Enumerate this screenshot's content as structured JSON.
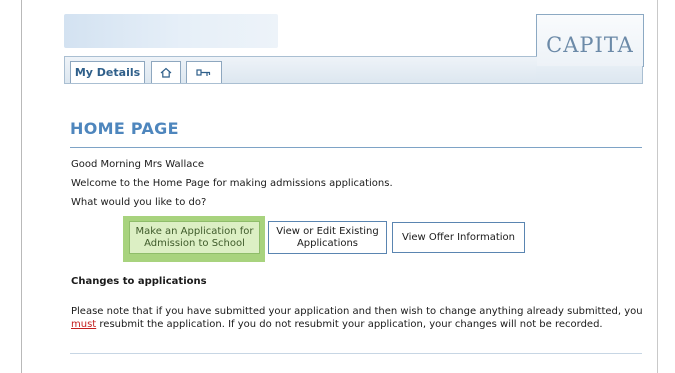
{
  "header": {
    "brand": "CAPITA",
    "tabs": [
      {
        "label": "My Details",
        "icon": "none"
      },
      {
        "label": "",
        "icon": "home-icon"
      },
      {
        "label": "",
        "icon": "key-icon"
      }
    ]
  },
  "main": {
    "title": "HOME PAGE",
    "greeting": "Good Morning Mrs Wallace",
    "welcome": "Welcome to the Home Page for making admissions applications.",
    "question": "What would you like to do?",
    "options": [
      {
        "label": "Make an Application for\nAdmission to School",
        "highlighted": true
      },
      {
        "label": "View or Edit Existing\nApplications",
        "highlighted": false
      },
      {
        "label": "View Offer Information",
        "highlighted": false
      }
    ],
    "changes": {
      "heading": "Changes to applications",
      "text_before": "Please note that if you have submitted your application and then wish to change anything already submitted, you ",
      "emphasis": "must",
      "text_after": " resubmit the application. If you do not resubmit your application, your changes will not be recorded."
    }
  },
  "colors": {
    "accent": "#4e86bd",
    "highlight": "#a8d37e",
    "brand": "#6c8aa8",
    "warning": "#c41f1f"
  }
}
